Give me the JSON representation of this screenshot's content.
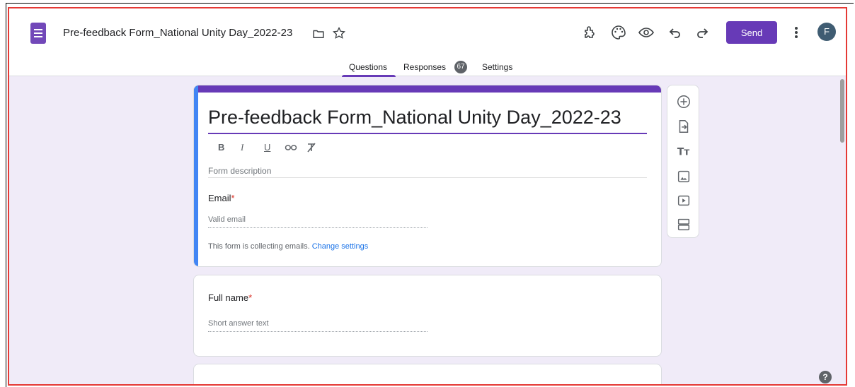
{
  "header": {
    "doc_title": "Pre-feedback Form_National Unity Day_2022-23",
    "send_label": "Send",
    "avatar_letter": "F"
  },
  "tabs": {
    "questions": "Questions",
    "responses": "Responses",
    "responses_count": "67",
    "settings": "Settings"
  },
  "form": {
    "title": "Pre-feedback Form_National Unity Day_2022-23",
    "format": {
      "bold": "B",
      "italic": "I",
      "underline": "U"
    },
    "description_placeholder": "Form description",
    "email_question": "Email",
    "email_placeholder": "Valid email",
    "collect_note": "This form is collecting emails.",
    "change_settings": "Change settings",
    "required_mark": "*"
  },
  "questions": [
    {
      "label": "Full name",
      "placeholder": "Short answer text"
    }
  ],
  "colors": {
    "accent": "#673ab7",
    "background": "#f0ebf8",
    "focus_bar": "#4285f4",
    "link": "#1a73e8",
    "required": "#d93025"
  }
}
